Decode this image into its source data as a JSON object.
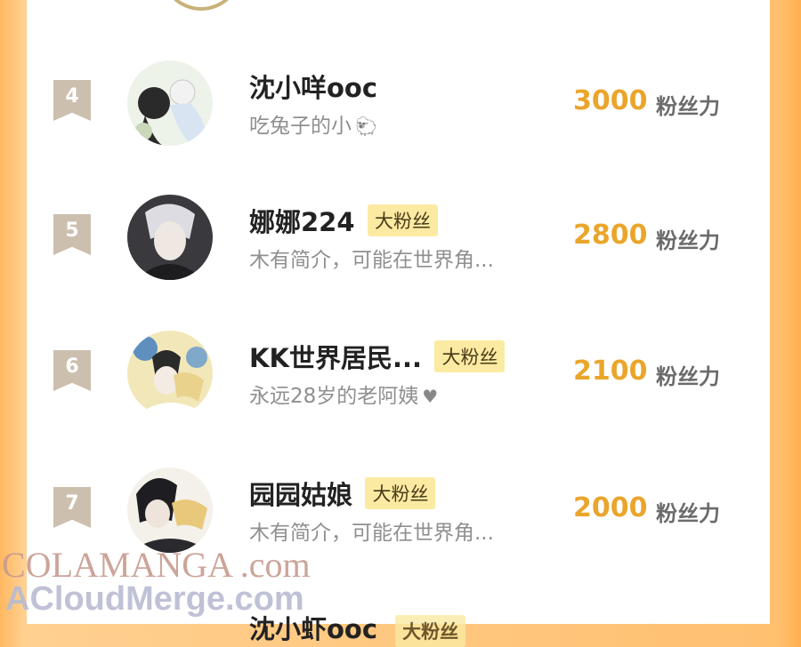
{
  "ranking": {
    "rows": [
      {
        "rank": "4",
        "name": "沈小咩ooc",
        "badge": "",
        "bio": "吃兔子的小",
        "bio_icon": "sheep-icon",
        "score": "3000",
        "unit": "粉丝力"
      },
      {
        "rank": "5",
        "name": "娜娜224",
        "badge": "大粉丝",
        "bio": "木有简介，可能在世界角...",
        "bio_icon": "",
        "score": "2800",
        "unit": "粉丝力"
      },
      {
        "rank": "6",
        "name": "KK世界居民...",
        "badge": "大粉丝",
        "bio": "永远28岁的老阿姨",
        "bio_icon": "heart-icon",
        "score": "2100",
        "unit": "粉丝力"
      },
      {
        "rank": "7",
        "name": "园园姑娘",
        "badge": "大粉丝",
        "bio": "木有简介，可能在世界角...",
        "bio_icon": "",
        "score": "2000",
        "unit": "粉丝力"
      }
    ],
    "partial_row": {
      "name": "沈小虾ooc",
      "badge": "大粉丝"
    }
  },
  "watermark": {
    "line1": "COLAMANGA .com",
    "line2": "ACloudMerge.com"
  },
  "colors": {
    "accent": "#eaa52b",
    "badge_bg": "#fbeaa2",
    "rank_bg": "#cdbfae",
    "frame": "#ffb860"
  }
}
